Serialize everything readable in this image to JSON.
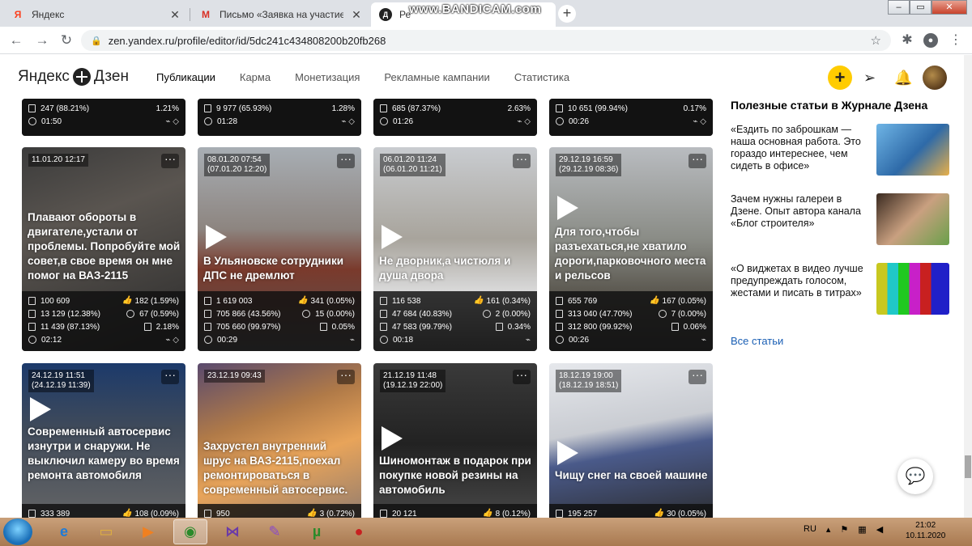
{
  "browser": {
    "tabs": [
      {
        "title": "Яндекс",
        "favicon": "Я",
        "color": "#fc3f1d"
      },
      {
        "title": "Письмо «Заявка на участие в п",
        "favicon": "M",
        "color": "#d93025"
      },
      {
        "title": "Ре",
        "favicon": "Д",
        "color": "#222222"
      }
    ],
    "watermark": "www.BANDICAM.com",
    "url": "zen.yandex.ru/profile/editor/id/5dc241c434808200b20fb268"
  },
  "zen": {
    "logo": {
      "left": "Яндекс",
      "right": "Дзен"
    },
    "nav": [
      "Публикации",
      "Карма",
      "Монетизация",
      "Рекламные кампании",
      "Статистика"
    ],
    "accent": "#ffcc00"
  },
  "cards_top": [
    {
      "views": "247 (88.21%)",
      "pct": "1.21%",
      "time": "01:50"
    },
    {
      "views": "9 977 (65.93%)",
      "pct": "1.28%",
      "time": "01:28"
    },
    {
      "views": "685 (87.37%)",
      "pct": "2.63%",
      "time": "01:26"
    },
    {
      "views": "10 651 (99.94%)",
      "pct": "0.17%",
      "time": "00:26"
    }
  ],
  "cards_mid": [
    {
      "date": "11.01.20 12:17",
      "date2": "",
      "title": "Плавают обороты в двигателе,устали от проблемы. Попробуйте мой совет,в свое время он мне помог на ВАЗ-2115",
      "s1": "100 609",
      "s2": "13 129 (12.38%)",
      "s3": "11 439 (87.13%)",
      "time": "02:12",
      "likes": "182 (1.59%)",
      "comments": "67 (0.59%)",
      "share": "2.18%"
    },
    {
      "date": "08.01.20 07:54",
      "date2": "(07.01.20 12:20)",
      "title": "В Ульяновске сотрудники ДПС не дремлют",
      "s1": "1 619 003",
      "s2": "705 866 (43.56%)",
      "s3": "705 660 (99.97%)",
      "time": "00:29",
      "likes": "341 (0.05%)",
      "comments": "15 (0.00%)",
      "share": "0.05%"
    },
    {
      "date": "06.01.20 11:24",
      "date2": "(06.01.20 11:21)",
      "title": "Не дворник,а чистюля и душа двора",
      "s1": "116 538",
      "s2": "47 684 (40.83%)",
      "s3": "47 583 (99.79%)",
      "time": "00:18",
      "likes": "161 (0.34%)",
      "comments": "2 (0.00%)",
      "share": "0.34%"
    },
    {
      "date": "29.12.19 16:59",
      "date2": "(29.12.19 08:36)",
      "title": "Для того,чтобы разъехаться,не хватило дороги,парковочного места и рельсов",
      "s1": "655 769",
      "s2": "313 040 (47.70%)",
      "s3": "312 800 (99.92%)",
      "time": "00:26",
      "likes": "167 (0.05%)",
      "comments": "7 (0.00%)",
      "share": "0.06%"
    }
  ],
  "cards_bot": [
    {
      "date": "24.12.19 11:51",
      "date2": "(24.12.19 11:39)",
      "title": "Современный автосервис изнутри и снаружи. Не выключил камеру во время ремонта автомобиля",
      "s1": "333 389",
      "likes": "108 (0.09%)"
    },
    {
      "date": "23.12.19 09:43",
      "date2": "",
      "title": "Захрустел внутренний шрус на ВАЗ-2115,поехал ремонтироваться в современный автосервис.",
      "s1": "950",
      "likes": "3 (0.72%)"
    },
    {
      "date": "21.12.19 11:48",
      "date2": "(19.12.19 22:00)",
      "title": "Шиномонтаж в подарок при покупке новой резины на автомобиль",
      "s1": "20 121",
      "likes": "8 (0.12%)"
    },
    {
      "date": "18.12.19 19:00",
      "date2": "(18.12.19 18:51)",
      "title": "Чищу снег на своей машине",
      "s1": "195 257",
      "likes": "30 (0.05%)"
    }
  ],
  "sidebar": {
    "heading": "Полезные статьи в Журнале Дзена",
    "articles": [
      {
        "text": "«Ездить по заброшкам — наша основная работа. Это гораздо интереснее, чем сидеть в офисе»"
      },
      {
        "text": "Зачем нужны галереи в Дзене. Опыт автора канала «Блог строителя»"
      },
      {
        "text": "«О виджетах в видео лучше предупреждать голосом, жестами и писать в титрах»"
      }
    ],
    "all_link": "Все статьи"
  },
  "taskbar": {
    "lang": "RU",
    "time": "21:02",
    "date": "10.11.2020"
  }
}
